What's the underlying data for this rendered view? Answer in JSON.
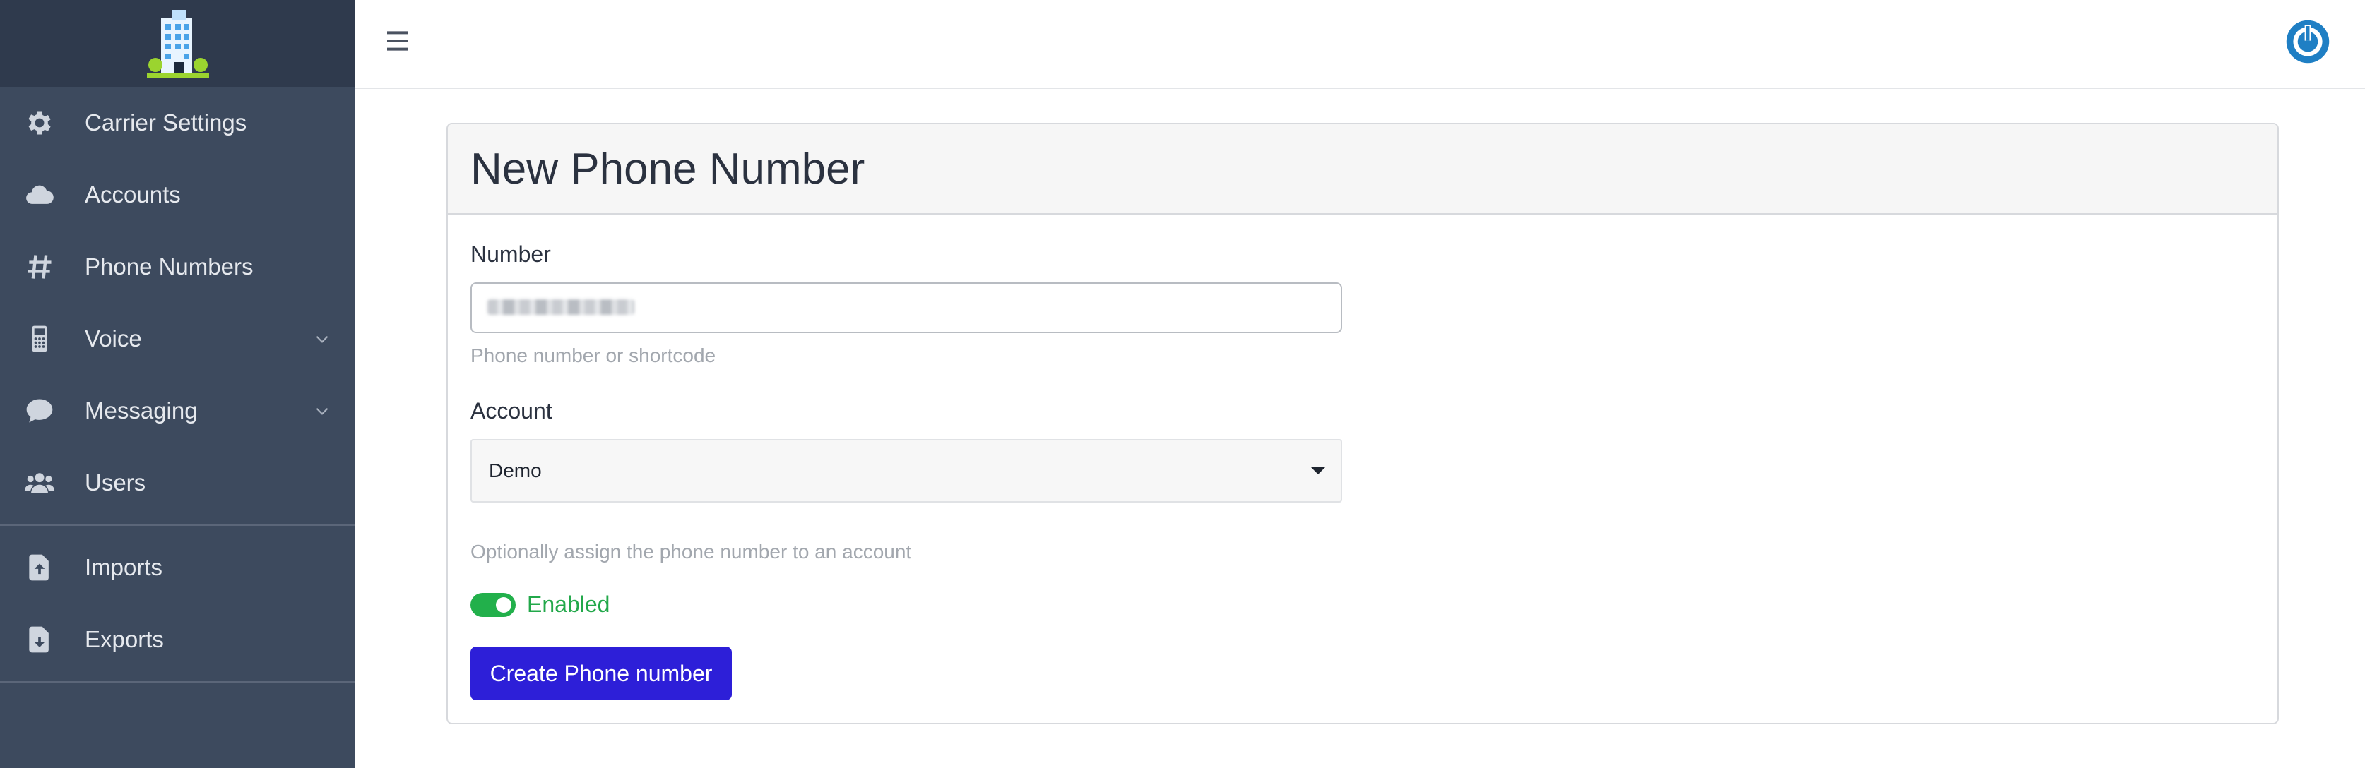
{
  "sidebar": {
    "items": [
      {
        "label": "Carrier Settings",
        "icon": "gear-icon"
      },
      {
        "label": "Accounts",
        "icon": "cloud-icon"
      },
      {
        "label": "Phone Numbers",
        "icon": "hashtag-icon"
      },
      {
        "label": "Voice",
        "icon": "phone-device-icon",
        "expandable": true
      },
      {
        "label": "Messaging",
        "icon": "chat-bubble-icon",
        "expandable": true
      },
      {
        "label": "Users",
        "icon": "users-icon"
      }
    ],
    "tools": [
      {
        "label": "Imports",
        "icon": "file-upload-icon"
      },
      {
        "label": "Exports",
        "icon": "file-download-icon"
      }
    ]
  },
  "form": {
    "title": "New Phone Number",
    "number_label": "Number",
    "number_help": "Phone number or shortcode",
    "account_label": "Account",
    "account_selected": "Demo",
    "account_help": "Optionally assign the phone number to an account",
    "enabled_label": "Enabled",
    "enabled": true,
    "submit_label": "Create Phone number"
  },
  "colors": {
    "sidebar_bg": "#3d4a5e",
    "brand_bg": "#2f3a4d",
    "primary": "#2d1fd8",
    "success": "#22b04b",
    "power_icon": "#1f7fc4"
  }
}
